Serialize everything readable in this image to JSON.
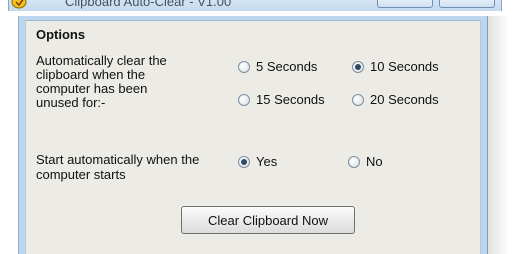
{
  "window": {
    "title": "Clipboard Auto-Clear - V1.00"
  },
  "options": {
    "heading": "Options",
    "description_lines": [
      "Automatically clear the",
      "clipboard when the",
      "computer has been",
      "unused for:-"
    ],
    "interval_options": [
      {
        "label": "5 Seconds",
        "selected": false
      },
      {
        "label": "10 Seconds",
        "selected": true
      },
      {
        "label": "15 Seconds",
        "selected": false
      },
      {
        "label": "20 Seconds",
        "selected": false
      }
    ],
    "start_label_lines": [
      "Start automatically when the",
      "computer starts"
    ],
    "start_options": [
      {
        "label": "Yes",
        "selected": true
      },
      {
        "label": "No",
        "selected": false
      }
    ]
  },
  "actions": {
    "clear_label": "Clear Clipboard Now"
  }
}
